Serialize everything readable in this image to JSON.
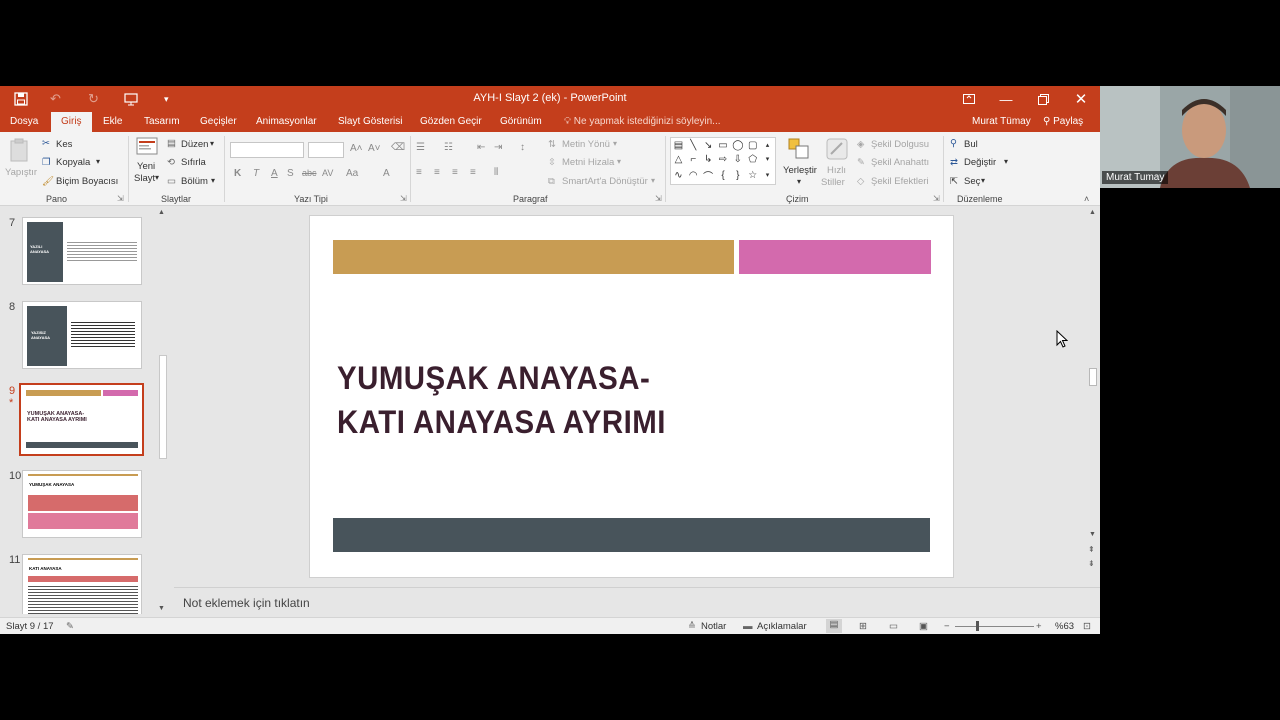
{
  "window": {
    "title": "AYH-I Slayt 2 (ek)  -  PowerPoint",
    "accent": "#c43e1c"
  },
  "tabs": {
    "file": "Dosya",
    "home": "Giriş",
    "insert": "Ekle",
    "design": "Tasarım",
    "transitions": "Geçişler",
    "animations": "Animasyonlar",
    "slideshow": "Slayt Gösterisi",
    "review": "Gözden Geçir",
    "view": "Görünüm",
    "tell_me": "Ne yapmak istediğinizi söyleyin...",
    "user": "Murat Tümay",
    "share": "Paylaş"
  },
  "ribbon": {
    "paste": "Yapıştır",
    "cut": "Kes",
    "copy": "Kopyala",
    "format_painter": "Biçim Boyacısı",
    "clipboard_group": "Pano",
    "new_slide_1": "Yeni",
    "new_slide_2": "Slayt",
    "layout": "Düzen",
    "reset": "Sıfırla",
    "section": "Bölüm",
    "slides_group": "Slaytlar",
    "font_group": "Yazı Tipi",
    "text_direction": "Metin Yönü",
    "align_text": "Metni Hizala",
    "smartart": "SmartArt'a Dönüştür",
    "paragraph_group": "Paragraf",
    "arrange": "Yerleştir",
    "quick_styles_1": "Hızlı",
    "quick_styles_2": "Stiller",
    "shape_fill": "Şekil Dolgusu",
    "shape_outline": "Şekil Anahattı",
    "shape_effects": "Şekil Efektleri",
    "drawing_group": "Çizim",
    "find": "Bul",
    "replace": "Değiştir",
    "select": "Seç",
    "editing_group": "Düzenleme",
    "font_buttons": [
      "K",
      "T",
      "A",
      "S",
      "abc",
      "AV",
      "Aa",
      "A"
    ]
  },
  "thumbnails": [
    {
      "num": "7",
      "title": "YAZILI ANAYASA"
    },
    {
      "num": "8",
      "title": "YAZISIZ ANAYASA"
    },
    {
      "num": "9",
      "star": "*",
      "title": "YUMUŞAK ANAYASA-\nKATI ANAYASA AYRIMI"
    },
    {
      "num": "10",
      "title": "YUMUŞAK ANAYASA"
    },
    {
      "num": "11",
      "title": "KATI ANAYASA"
    }
  ],
  "slide": {
    "title_line1": "YUMUŞAK ANAYASA-",
    "title_line2": "KATI ANAYASA AYRIMI",
    "colors": {
      "gold": "#c89c53",
      "pink": "#d36aad",
      "dark": "#48545b",
      "title": "#3a1f2e"
    }
  },
  "notes": {
    "placeholder": "Not eklemek için tıklatın"
  },
  "status": {
    "slide_counter": "Slayt 9 / 17",
    "notes": "Notlar",
    "comments": "Açıklamalar",
    "zoom": "%63"
  },
  "webcam": {
    "name": "Murat Tumay"
  }
}
